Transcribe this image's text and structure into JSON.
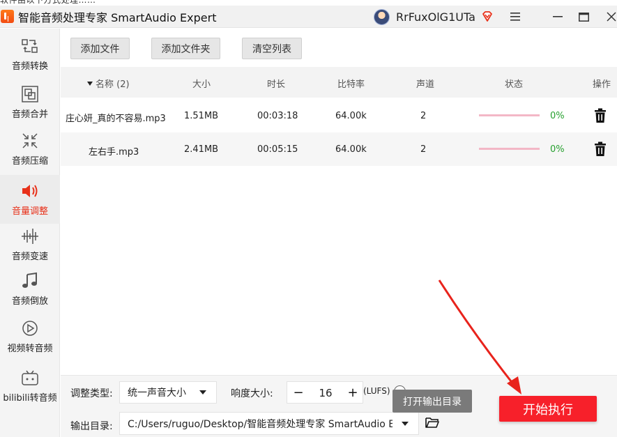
{
  "top_strip_text": "软件由以下方式处理……",
  "titlebar": {
    "title": "智能音频处理专家 SmartAudio Expert",
    "username": "RrFuxOlG1UTa"
  },
  "sidebar": {
    "items": [
      {
        "label": "音频转换",
        "icon": "convert-icon"
      },
      {
        "label": "音频合并",
        "icon": "merge-icon"
      },
      {
        "label": "音频压缩",
        "icon": "compress-icon"
      },
      {
        "label": "音量调整",
        "icon": "volume-icon",
        "active": true
      },
      {
        "label": "音频变速",
        "icon": "speed-icon"
      },
      {
        "label": "音频倒放",
        "icon": "reverse-icon"
      },
      {
        "label": "视频转音频",
        "icon": "video-play-icon"
      },
      {
        "label": "bilibili转音频",
        "icon": "bilibili-tv-icon"
      }
    ]
  },
  "toolbar": {
    "add_file": "添加文件",
    "add_folder": "添加文件夹",
    "clear_list": "清空列表"
  },
  "table": {
    "headers": {
      "name": "名称 (2)",
      "size": "大小",
      "duration": "时长",
      "bitrate": "比特率",
      "channels": "声道",
      "status": "状态",
      "action": "操作"
    },
    "rows": [
      {
        "name": "庄心妍_真的不容易.mp3",
        "size": "1.51MB",
        "duration": "00:03:18",
        "bitrate": "64.00k",
        "channels": "2",
        "progress_pct": 0,
        "pct": "0%"
      },
      {
        "name": "左右手.mp3",
        "size": "2.41MB",
        "duration": "00:05:15",
        "bitrate": "64.00k",
        "channels": "2",
        "progress_pct": 0,
        "pct": "0%"
      }
    ]
  },
  "bottom": {
    "adjust_type_label": "调整类型:",
    "adjust_type_value": "统一声音大小",
    "loudness_label": "响度大小:",
    "loudness_value": "16",
    "minus": "−",
    "plus": "+",
    "lufs": "(LUFS)",
    "output_label": "输出目录:",
    "output_path": "C:/Users/ruguo/Desktop/智能音频处理专家 SmartAudio Ex",
    "open_output": "打开输出目录",
    "start": "开始执行"
  },
  "colors": {
    "accent_red": "#f7202a",
    "active_label": "#e8311a",
    "progress_track": "#f3b7c6",
    "progress_text": "#27a02f",
    "annotation_arrow": "#e8231c"
  }
}
